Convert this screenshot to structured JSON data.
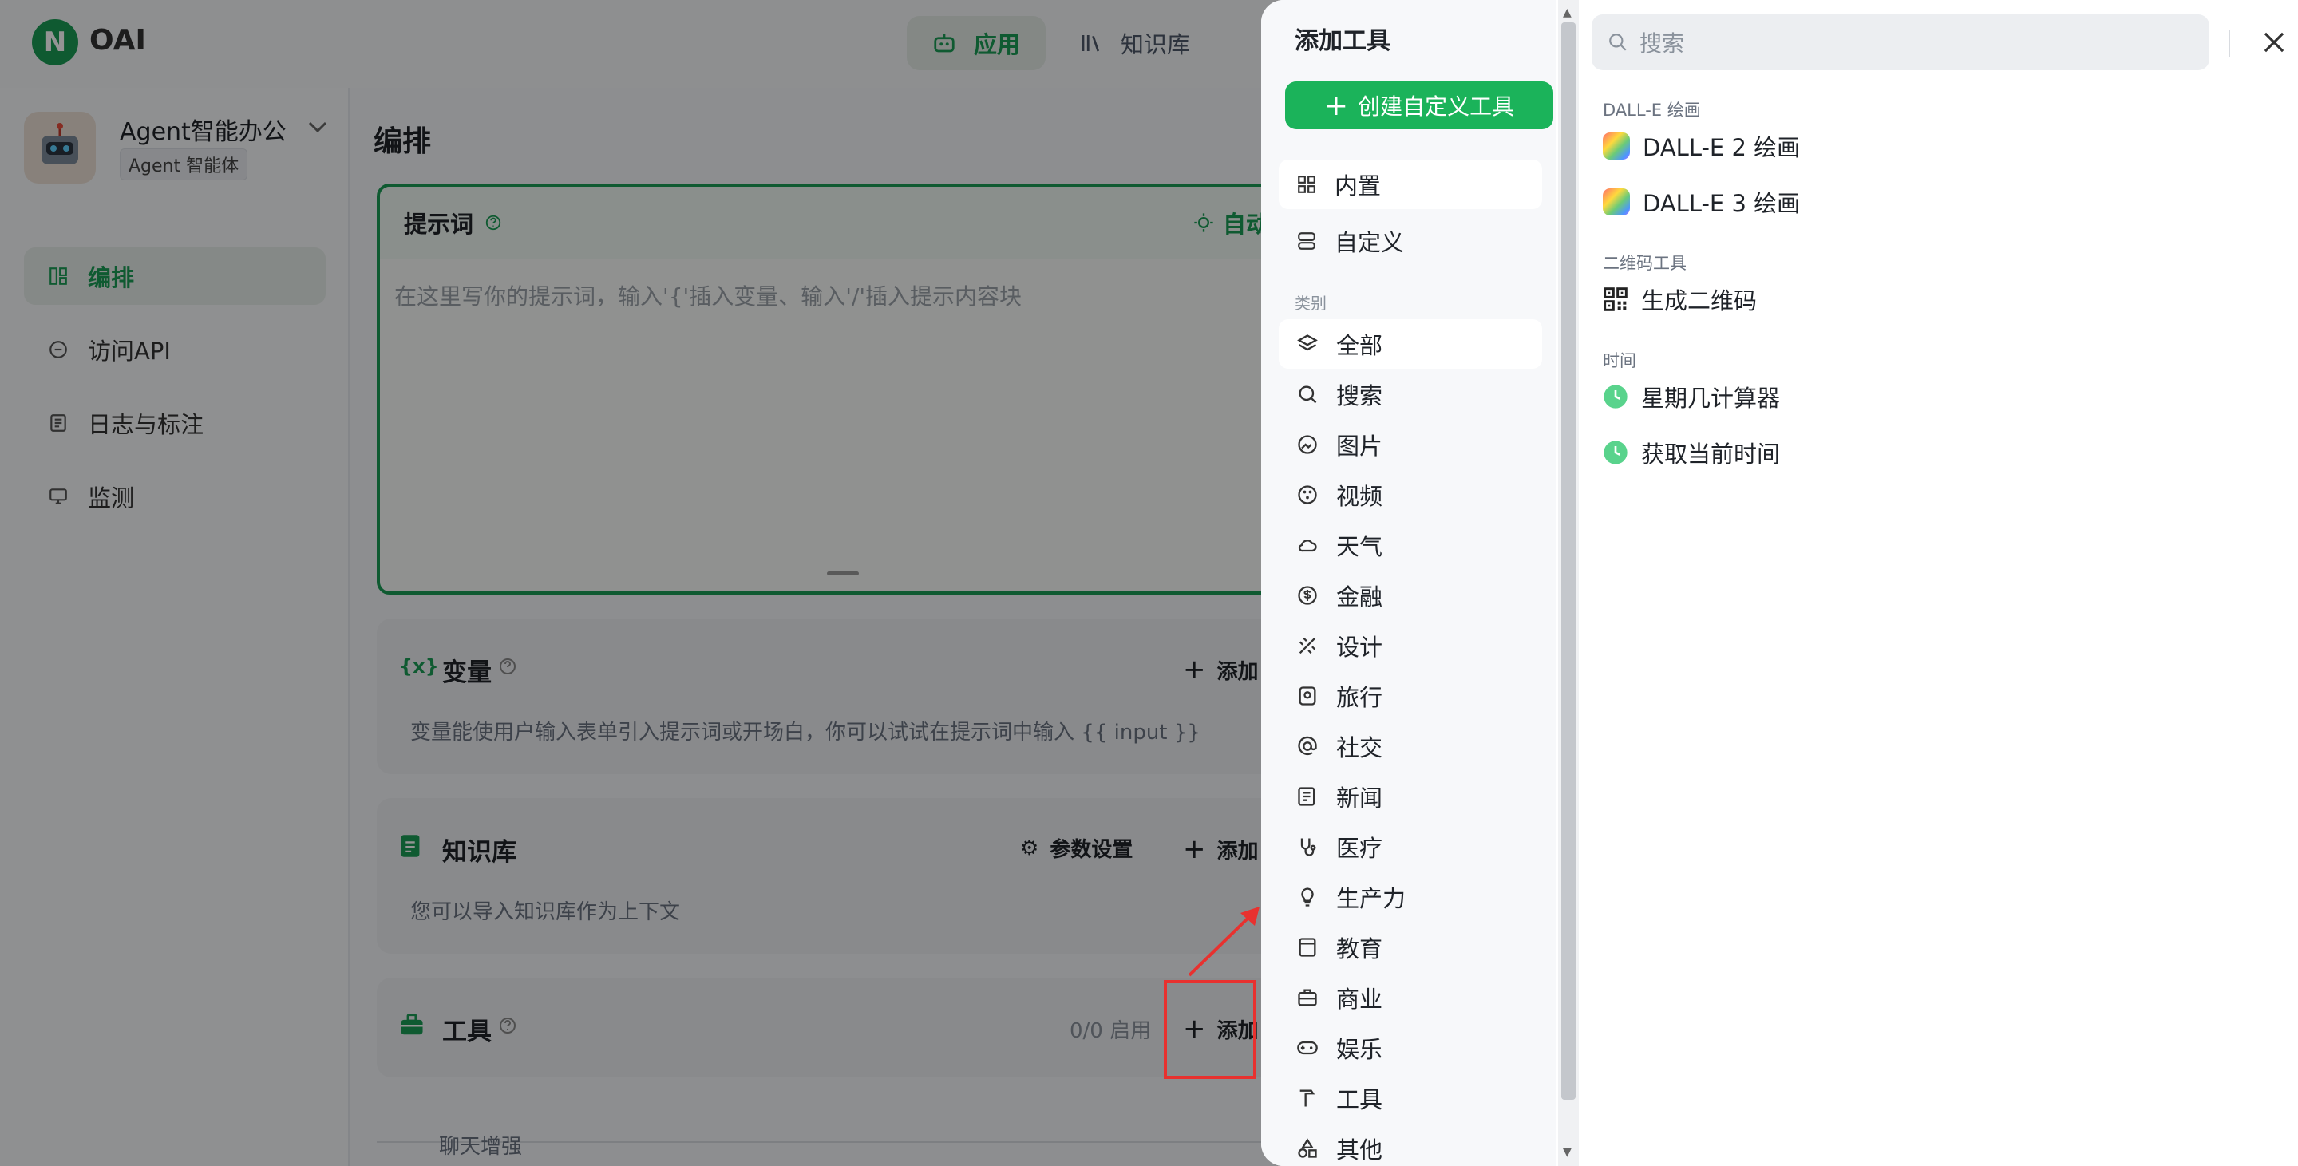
{
  "app": {
    "logo_text": "OAI"
  },
  "nav": {
    "tabs": [
      {
        "label": "应用",
        "active": true
      },
      {
        "label": "知识库",
        "active": false
      }
    ]
  },
  "sidebar": {
    "agent_name": "Agent智能办公",
    "agent_type": "Agent 智能体",
    "items": [
      {
        "label": "编排",
        "active": true
      },
      {
        "label": "访问API",
        "active": false
      },
      {
        "label": "日志与标注",
        "active": false
      },
      {
        "label": "监测",
        "active": false
      }
    ]
  },
  "main": {
    "title": "编排",
    "prompt": {
      "label": "提示词",
      "auto_label": "自动编排",
      "placeholder": "在这里写你的提示词，输入'{'插入变量、输入'/'插入提示内容块"
    },
    "variables": {
      "icon_text": "{x}",
      "title": "变量",
      "add_label": "添加",
      "desc": "变量能使用户输入表单引入提示词或开场白，你可以试试在提示词中输入 {{ input }}"
    },
    "knowledge": {
      "title": "知识库",
      "settings_label": "参数设置",
      "add_label": "添加",
      "desc": "您可以导入知识库作为上下文"
    },
    "tools": {
      "title": "工具",
      "status": "0/0 启用",
      "add_label": "添加"
    },
    "chat_enhance": {
      "label": "聊天增强"
    }
  },
  "modal": {
    "title": "添加工具",
    "create_label": "创建自定义工具",
    "sources": [
      {
        "label": "内置",
        "active": true
      },
      {
        "label": "自定义",
        "active": false
      }
    ],
    "category_heading": "类别",
    "categories": [
      {
        "label": "全部",
        "icon": "layers-icon",
        "active": true
      },
      {
        "label": "搜索",
        "icon": "search-icon"
      },
      {
        "label": "图片",
        "icon": "image-icon"
      },
      {
        "label": "视频",
        "icon": "video-icon"
      },
      {
        "label": "天气",
        "icon": "cloud-icon"
      },
      {
        "label": "金融",
        "icon": "dollar-icon"
      },
      {
        "label": "设计",
        "icon": "design-icon"
      },
      {
        "label": "旅行",
        "icon": "travel-icon"
      },
      {
        "label": "社交",
        "icon": "at-icon"
      },
      {
        "label": "新闻",
        "icon": "news-icon"
      },
      {
        "label": "医疗",
        "icon": "medical-icon"
      },
      {
        "label": "生产力",
        "icon": "bulb-icon"
      },
      {
        "label": "教育",
        "icon": "book-icon"
      },
      {
        "label": "商业",
        "icon": "briefcase-icon"
      },
      {
        "label": "娱乐",
        "icon": "gamepad-icon"
      },
      {
        "label": "工具",
        "icon": "hammer-icon"
      },
      {
        "label": "其他",
        "icon": "shapes-icon"
      }
    ],
    "search_placeholder": "搜索",
    "groups": [
      {
        "label": "DALL-E 绘画",
        "tools": [
          {
            "label": "DALL-E 2 绘画",
            "icon": "dalle-icon"
          },
          {
            "label": "DALL-E 3 绘画",
            "icon": "dalle-icon"
          }
        ]
      },
      {
        "label": "二维码工具",
        "tools": [
          {
            "label": "生成二维码",
            "icon": "qrcode-icon"
          }
        ]
      },
      {
        "label": "时间",
        "tools": [
          {
            "label": "星期几计算器",
            "icon": "clock-icon"
          },
          {
            "label": "获取当前时间",
            "icon": "clock-icon"
          }
        ]
      }
    ]
  },
  "colors": {
    "accent": "#1a9c55",
    "button_green": "#1bb35a",
    "annotation_red": "#e8312f"
  }
}
